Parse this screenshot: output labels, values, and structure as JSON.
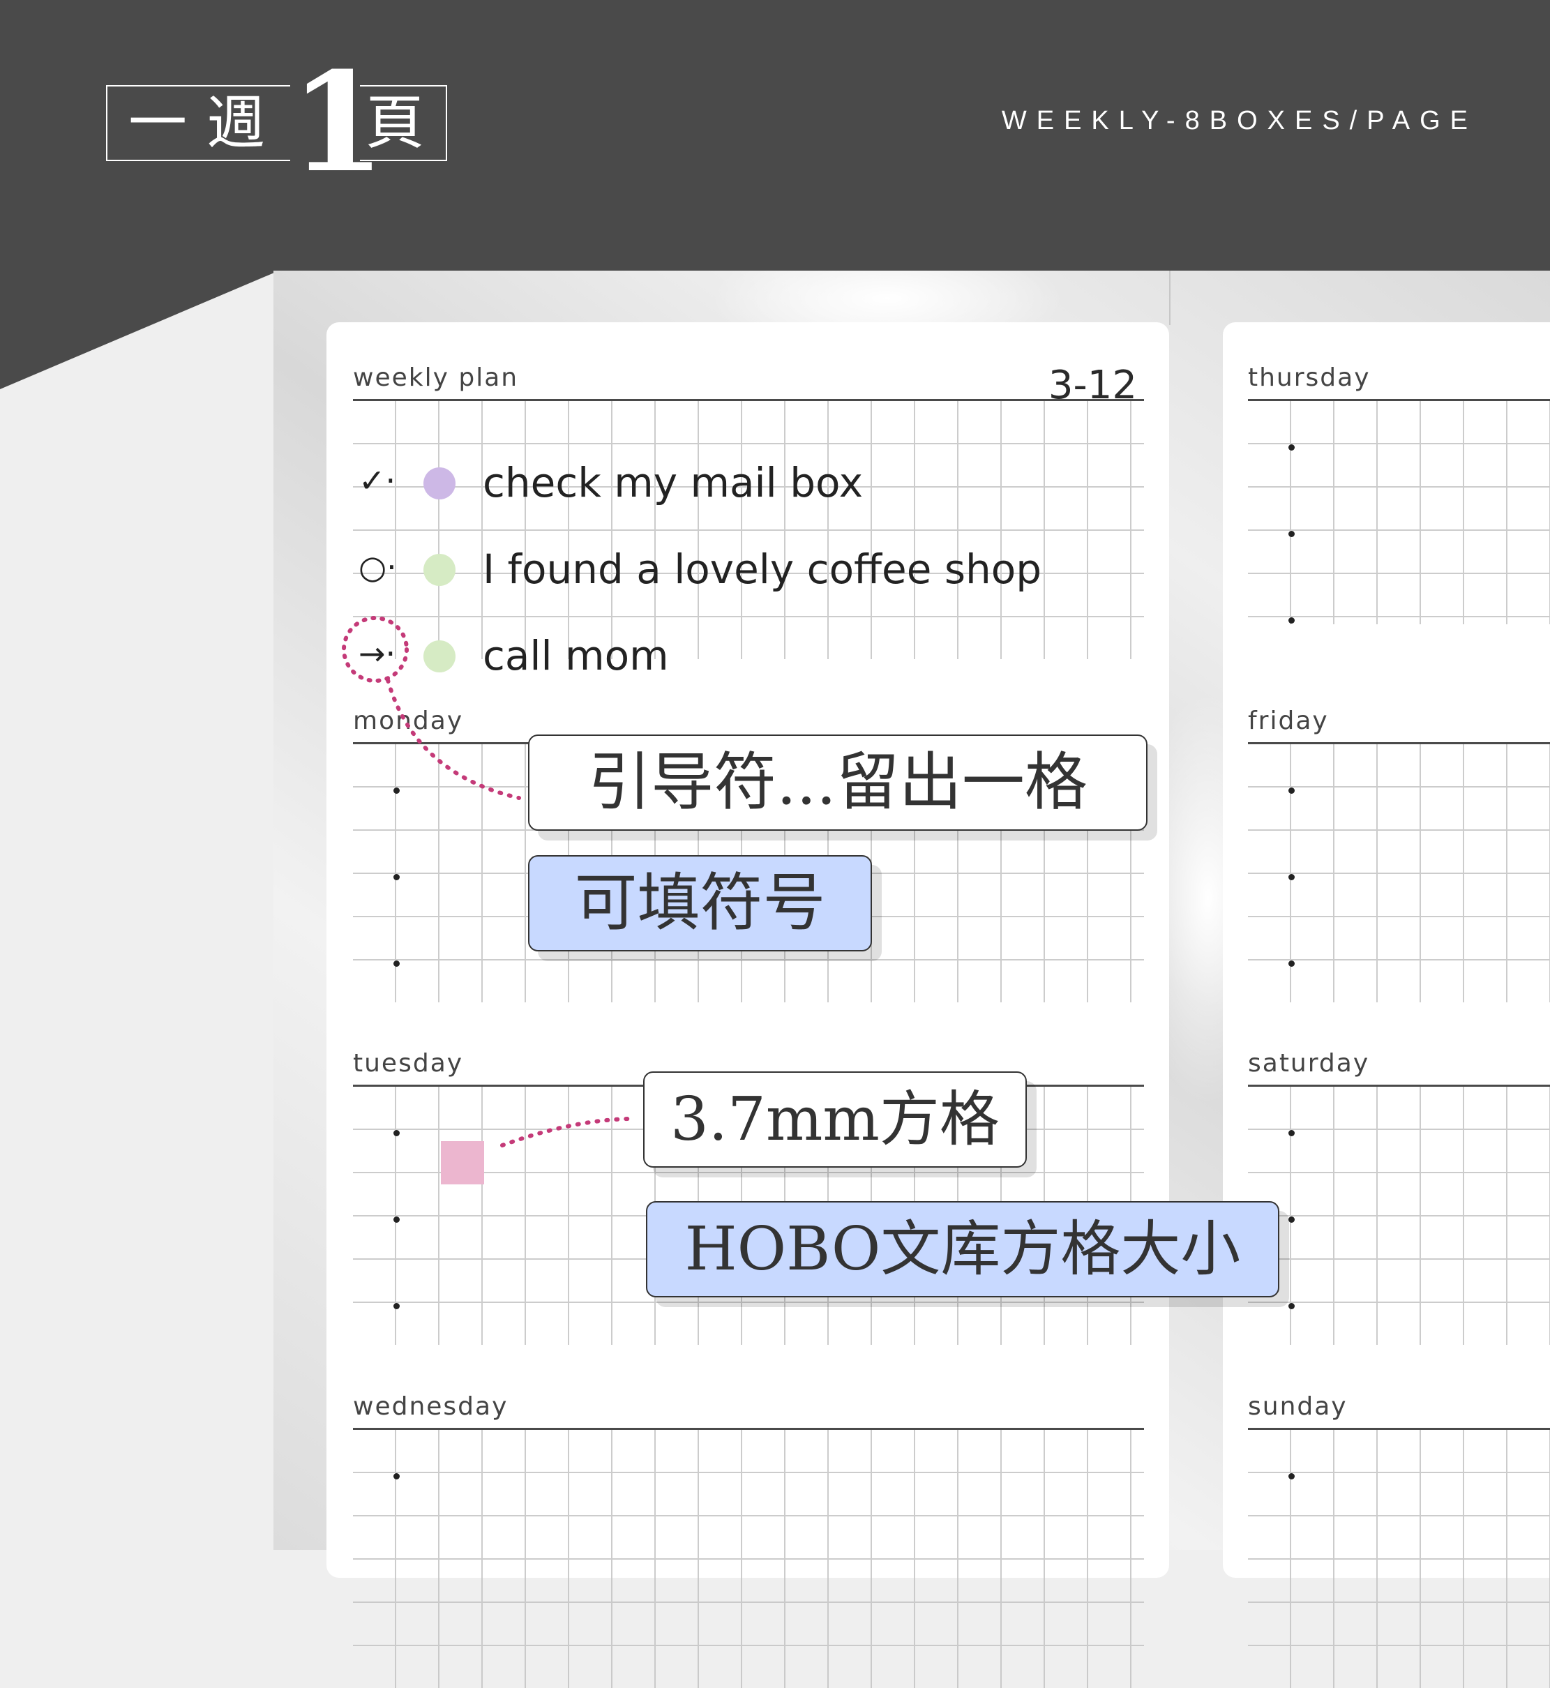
{
  "header": {
    "logo_char1": "一",
    "logo_char2": "週",
    "logo_number": "1",
    "logo_char3": "頁",
    "subtitle": "WEEKLY-8BOXES/PAGE"
  },
  "weekly_plan": {
    "label": "weekly plan",
    "date": "3-12",
    "tasks": [
      {
        "symbol": "✓·",
        "dot_color": "#cdb8e6",
        "text": "check my mail box"
      },
      {
        "symbol": "○·",
        "dot_color": "#d6ebc4",
        "text": "I found a lovely coffee shop"
      },
      {
        "symbol": "→·",
        "dot_color": "#d6ebc4",
        "text": "call mom"
      }
    ]
  },
  "days": {
    "monday": "monday",
    "tuesday": "tuesday",
    "wednesday": "wednesday",
    "thursday": "thursday",
    "friday": "friday",
    "saturday": "saturday",
    "sunday": "sunday"
  },
  "callouts": {
    "guide_symbol": "引导符...留出一格",
    "fillable_symbol": "可填符号",
    "grid_size": "3.7mm方格",
    "hobo_grid": "HOBO文库方格大小"
  },
  "colors": {
    "header_bg": "#4a4a4a",
    "accent_dotted": "#c43a78",
    "callout_blue": "#c8d9ff",
    "swatch_pink": "#ecb6cf"
  }
}
